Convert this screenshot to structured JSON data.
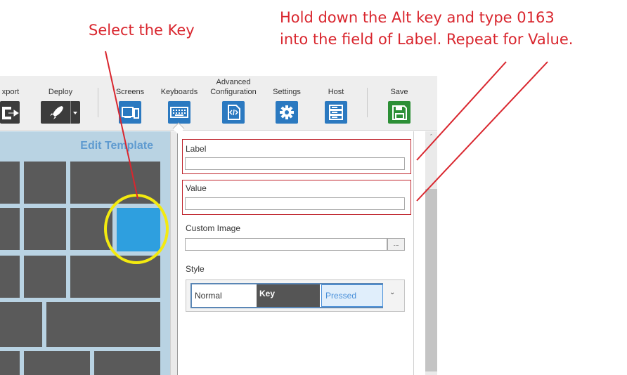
{
  "annotations": {
    "select_key": "Select the Key",
    "hold_line1": "Hold down the Alt key and type 0163",
    "hold_line2": "into the field of Label. Repeat for Value."
  },
  "toolbar": {
    "export_label": "xport",
    "deploy_label": "Deploy",
    "screens_label": "Screens",
    "keyboards_label": "Keyboards",
    "advanced_line1": "Advanced",
    "advanced_line2": "Configuration",
    "settings_label": "Settings",
    "host_label": "Host",
    "save_label": "Save",
    "icons": [
      "export-icon",
      "rocket-icon",
      "screens-icon",
      "keyboard-icon",
      "code-file-icon",
      "gear-icon",
      "host-icon",
      "save-icon"
    ]
  },
  "template": {
    "title": "Edit Template"
  },
  "properties": {
    "label_title": "Label",
    "label_value": "",
    "value_title": "Value",
    "value_value": "",
    "custom_image_title": "Custom Image",
    "custom_image_value": "",
    "browse_label": "...",
    "style_title": "Style",
    "style_normal": "Normal",
    "style_key": "Key",
    "style_pressed": "Pressed"
  },
  "colors": {
    "annotation_red": "#d9262e",
    "selected_key": "#2e9fdf",
    "key": "#5a5a5a",
    "template_bg": "#b9d3e3",
    "toolbar_icon_blue": "#2b79c0",
    "save_green": "#2c8f36"
  }
}
